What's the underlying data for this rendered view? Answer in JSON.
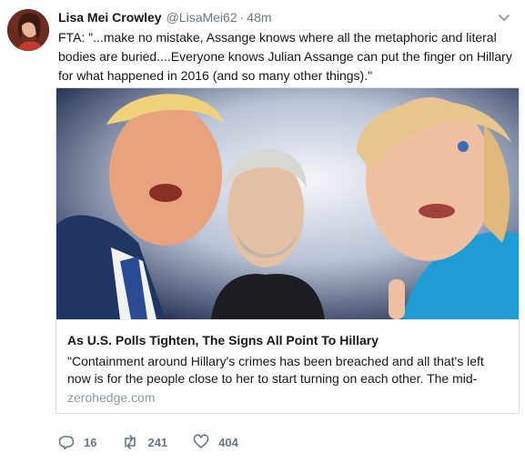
{
  "tweet": {
    "author_name": "Lisa Mei Crowley",
    "handle": "@LisaMei62",
    "separator": "·",
    "time": "48m",
    "text": "FTA: \"...make no mistake, Assange knows where all the metaphoric and literal bodies are buried....Everyone knows Julian Assange can put the finger on Hillary for what happened in 2016 (and so many other things).\""
  },
  "card": {
    "title": "As U.S. Polls Tighten, The Signs All Point To Hillary",
    "description": "\"Containment around Hillary's crimes has been breached and all that's left now is for the people close to her to start turning on each other. The mid-",
    "domain": "zerohedge.com"
  },
  "actions": {
    "replies": "16",
    "retweets": "241",
    "likes": "404"
  },
  "icons": {
    "reply": "reply-icon",
    "retweet": "retweet-icon",
    "like": "heart-icon",
    "caret": "chevron-down-icon"
  },
  "colors": {
    "text": "#14171a",
    "muted": "#657786",
    "retweet_green": "#17bf63",
    "border": "#d9dee2"
  }
}
